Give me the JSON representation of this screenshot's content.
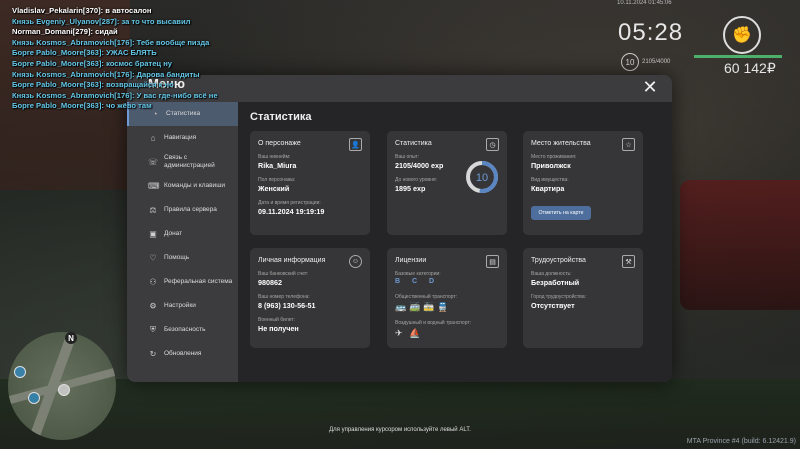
{
  "chat": [
    {
      "text": "Vladislav_Pekalarin[370]: в автосалон",
      "color": "#ffffff"
    },
    {
      "text": "Князь Evgeniy_Ulyanov[287]: за то что высавил",
      "color": "#64c8e8"
    },
    {
      "text": "Norman_Domani[279]: сидай",
      "color": "#ffffff"
    },
    {
      "text": "Князь Kosmos_Abramovich[176]: Тебе вообще пизда",
      "color": "#64c8e8"
    },
    {
      "text": "Боpre Pablo_Moore[363]: УЖАС БЛЯТЬ",
      "color": "#64c8e8"
    },
    {
      "text": "Боpre Pablo_Moore[363]: космос братец ну",
      "color": "#64c8e8"
    },
    {
      "text": "Князь Kosmos_Abramovich[176]: Дарова бандиты",
      "color": "#64c8e8"
    },
    {
      "text": "Боpre Pablo_Moore[363]: возвращайся к но",
      "color": "#64c8e8"
    },
    {
      "text": "Князь Kosmos_Abramovich[176]: У вас где-нибо всё не",
      "color": "#64c8e8"
    },
    {
      "text": "Боpre Pablo_Moore[363]: чо жёво там",
      "color": "#64c8e8"
    }
  ],
  "hud": {
    "date": "10.11.2024 01:45:06",
    "time": "05:28",
    "level": "10",
    "xp": "2105/4000",
    "money": "60 142₽",
    "health_fraction": 1.0
  },
  "menu": {
    "title": "Меню",
    "close": "✕",
    "items": [
      {
        "label": "Статистика",
        "icon": "◔",
        "active": true
      },
      {
        "label": "Навигация",
        "icon": "⌂"
      },
      {
        "label": "Связь с администрацией",
        "icon": "☏"
      },
      {
        "label": "Команды и клавиши",
        "icon": "⌨"
      },
      {
        "label": "Правила сервера",
        "icon": "⚖"
      },
      {
        "label": "Донат",
        "icon": "▣"
      },
      {
        "label": "Помощь",
        "icon": "♡"
      },
      {
        "label": "Реферальная система",
        "icon": "⚇"
      },
      {
        "label": "Настройки",
        "icon": "⚙"
      },
      {
        "label": "Безопасность",
        "icon": "⛨"
      },
      {
        "label": "Обновления",
        "icon": "↻"
      }
    ]
  },
  "stats": {
    "title": "Статистика",
    "person": {
      "title": "О персонаже",
      "nick_label": "Ваш никнейм:",
      "nick": "Rika_Miura",
      "gender_label": "Пол персонажа:",
      "gender": "Женский",
      "reg_label": "Дата и время регистрации:",
      "reg": "09.11.2024 19:19:19"
    },
    "statistic": {
      "title": "Статистика",
      "exp_label": "Ваш опыт:",
      "exp": "2105/4000 exp",
      "next_label": "До нового уровня:",
      "next": "1895 exp",
      "level": "10",
      "progress": 0.526
    },
    "residence": {
      "title": "Место жительства",
      "place_label": "Место проживания:",
      "place": "Приволжск",
      "prop_label": "Вид имущества:",
      "prop": "Квартира",
      "button": "Отметить на карте"
    },
    "personal": {
      "title": "Личная информация",
      "bank_label": "Ваш банковский счет:",
      "bank": "980862",
      "phone_label": "Ваш номер телефона:",
      "phone": "8 (963) 130-56-51",
      "military_label": "Военный билет:",
      "military": "Не получен"
    },
    "licenses": {
      "title": "Лицензии",
      "base_label": "Базовые категории:",
      "base": "B C D",
      "public_label": "Общественный транспорт:",
      "air_label": "Воздушный и водный транспорт:"
    },
    "job": {
      "title": "Трудоустройства",
      "position_label": "Ваша должность:",
      "position": "Безработный",
      "city_label": "Город трудоустройства:",
      "city": "Отсутствует"
    }
  },
  "hint": "Для управления курсором используйте левый ALT.",
  "build": "MTA Province #4 (build: 6.12421.9)"
}
